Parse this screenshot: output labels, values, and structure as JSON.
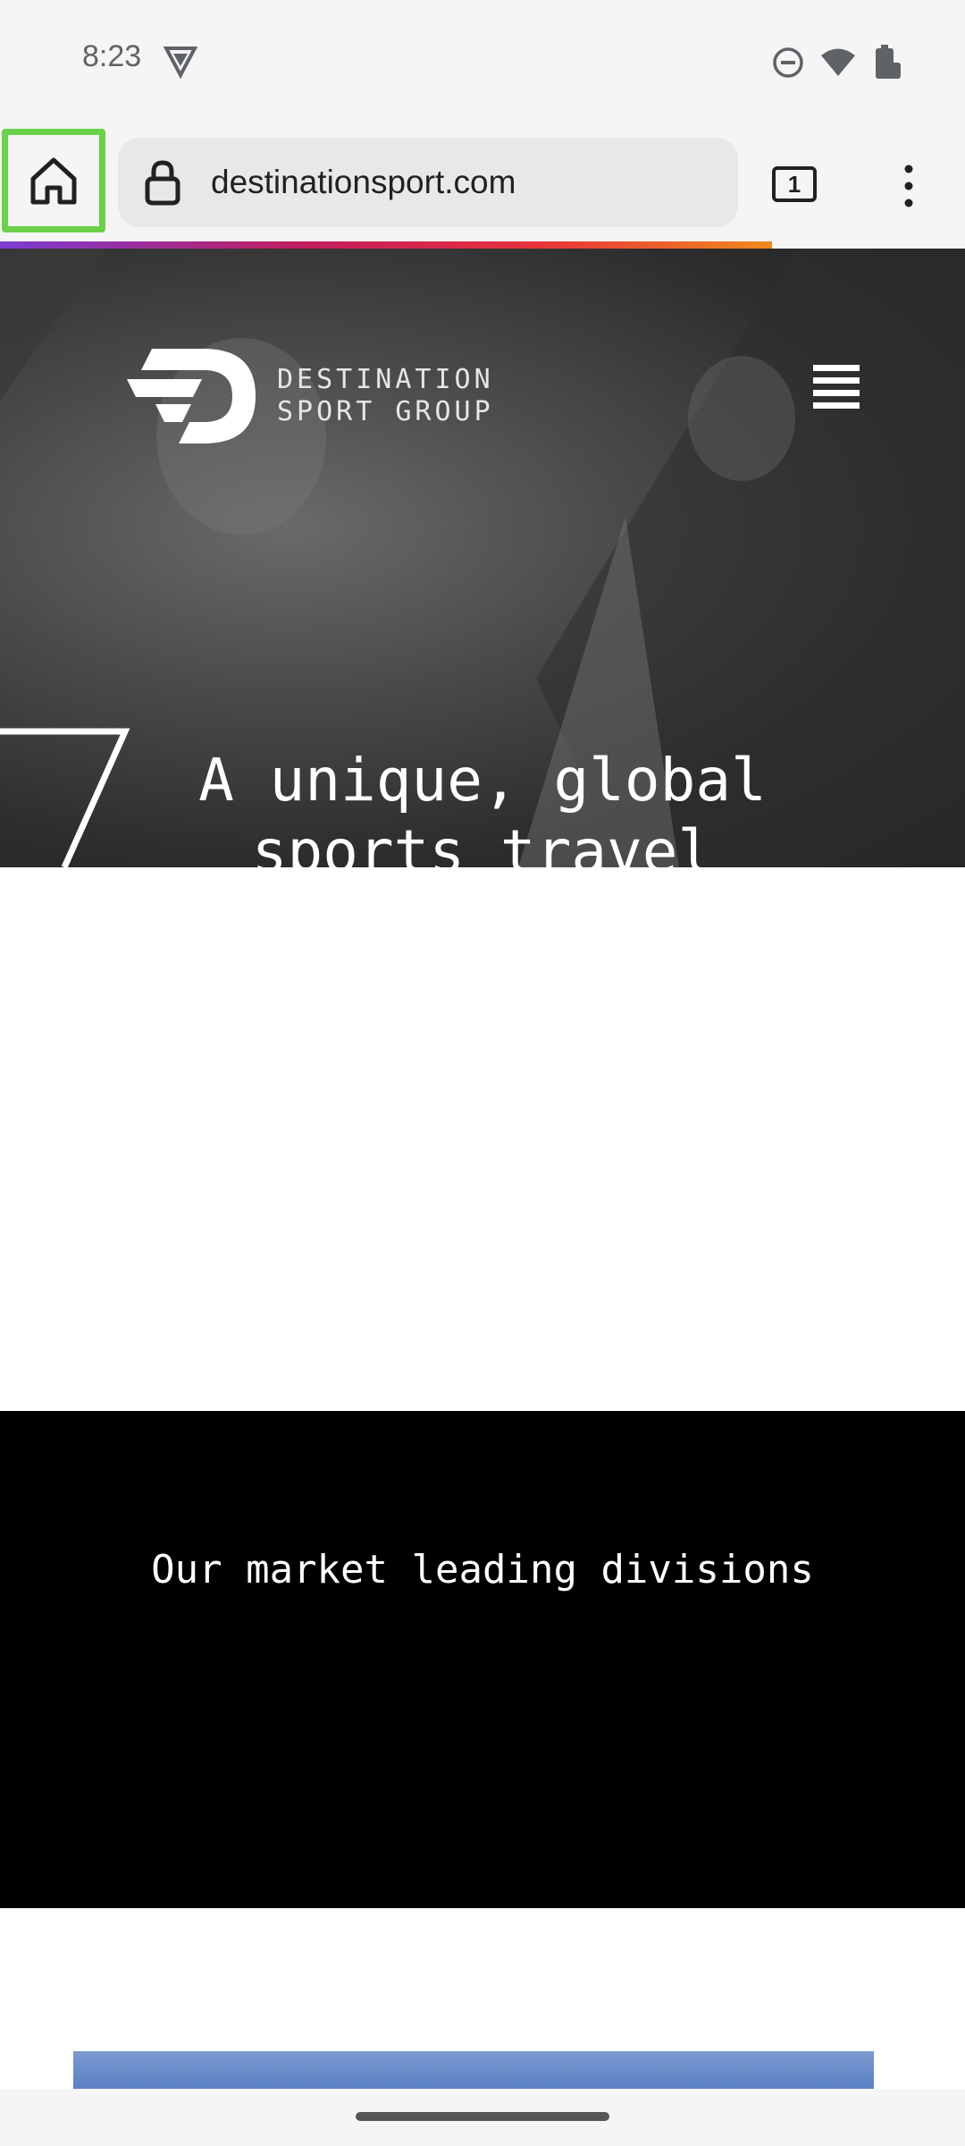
{
  "status_bar": {
    "time": "8:23"
  },
  "browser": {
    "url": "destinationsport.com",
    "tab_count": "1"
  },
  "hero": {
    "logo_line1": "DESTINATION",
    "logo_line2": "SPORT GROUP",
    "heading": "A unique, global sports travel"
  },
  "divisions": {
    "title": "Our market leading divisions"
  },
  "colors": {
    "highlight": "#6bd14a",
    "progress_start": "#7a3dd1",
    "progress_end": "#f08a1c"
  }
}
